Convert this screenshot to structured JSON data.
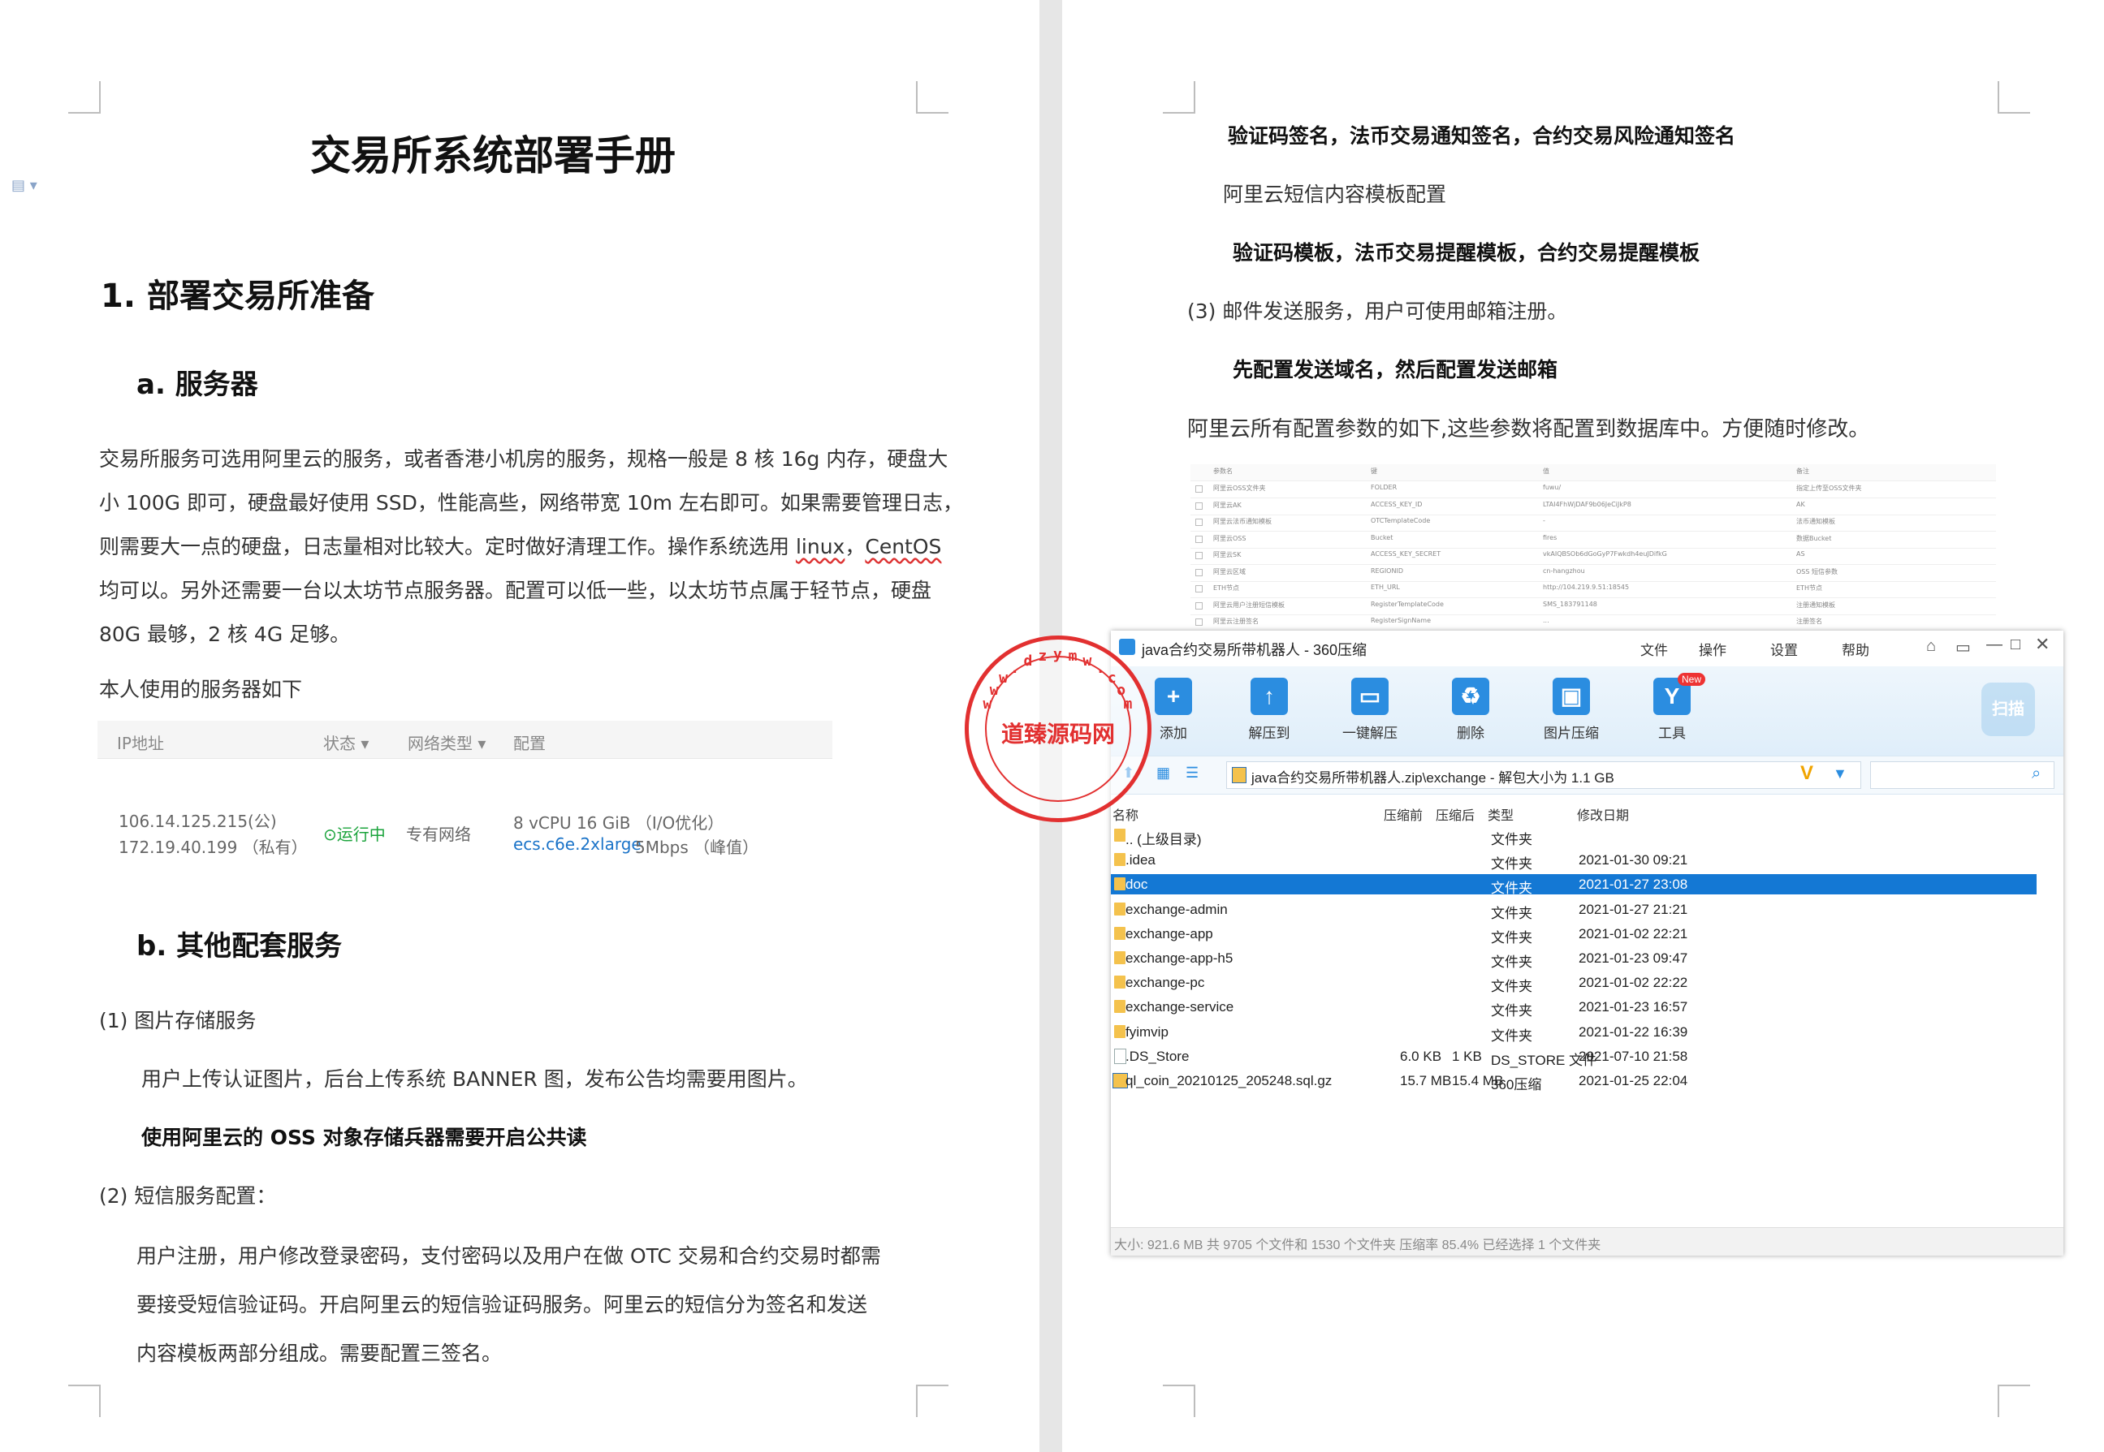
{
  "left_page": {
    "doc_title": "交易所系统部署手册",
    "section1_title": "1.  部署交易所准备",
    "sub_a_title": "a.  服务器",
    "para_lines": [
      "交易所服务可选用阿里云的服务，或者香港小机房的服务，规格一般是 8 核 16g 内存，硬盘大",
      "小 100G 即可，硬盘最好使用 SSD，性能高些，网络带宽 10m 左右即可。如果需要管理日志，",
      "则需要大一点的硬盘，日志量相对比较大。定时做好清理工作。操作系统选用 ",
      "均可以。另外还需要一台以太坊节点服务器。配置可以低一些，以太坊节点属于轻节点，硬盘",
      "80G 最够，2 核 4G 足够。"
    ],
    "os_linux": "linux",
    "os_sep": "，",
    "os_centos": "CentOS",
    "server_caption": "本人使用的服务器如下",
    "server_table": {
      "headers": [
        "IP地址",
        "状态 ▾",
        "网络类型 ▾",
        "配置"
      ],
      "ip_public": "106.14.125.215(公)",
      "ip_private": "172.19.40.199 （私有）",
      "status": "运行中",
      "network": "专有网络",
      "config_line1": "8 vCPU 16 GiB  （I/O优化）",
      "config_instance": "ecs.c6e.2xlarge",
      "config_bandwidth": "5Mbps  （峰值）"
    },
    "sub_b_title": "b.  其他配套服务",
    "item1": "(1) 图片存储服务",
    "item1_desc": "用户上传认证图片，后台上传系统 BANNER 图，发布公告均需要用图片。",
    "item1_bold": "使用阿里云的  OSS 对象存储兵器需要开启公共读",
    "item2": "(2) 短信服务配置：",
    "item2_lines": [
      "用户注册，用户修改登录密码，支付密码以及用户在做 OTC 交易和合约交易时都需",
      "要接受短信验证码。开启阿里云的短信验证码服务。阿里云的短信分为签名和发送",
      "内容模板两部分组成。需要配置三签名。"
    ]
  },
  "right_page": {
    "line_signs": "验证码签名，法币交易通知签名，合约交易风险通知签名",
    "line_template_cfg": "阿里云短信内容模板配置",
    "line_templates": "验证码模板，法币交易提醒模板，合约交易提醒模板",
    "item3": "(3) 邮件发送服务，用户可使用邮箱注册。",
    "line_mail": "先配置发送域名，然后配置发送邮箱",
    "line_params": "阿里云所有配置参数的如下,这些参数将配置到数据库中。方便随时修改。",
    "config_table": {
      "headers": [
        "参数名",
        "键",
        "值",
        "备注"
      ],
      "rows": [
        [
          "阿里云OSS文件夹",
          "FOLDER",
          "fuwu/",
          "指定上传至OSS文件夹"
        ],
        [
          "阿里云AK",
          "ACCESS_KEY_ID",
          "LTAI4FhWjDAF9b06JeCiJkP8",
          "AK"
        ],
        [
          "阿里云法币通知模板",
          "OTCTemplateCode",
          "-",
          "法币通知模板"
        ],
        [
          "阿里云OSS",
          "Bucket",
          "fires",
          "数据Bucket"
        ],
        [
          "阿里云SK",
          "ACCESS_KEY_SECRET",
          "vkAIQBSOb6dGoGyP7Fwkdh4euJDifkG",
          "AS"
        ],
        [
          "阿里云区域",
          "REGIONID",
          "cn-hangzhou",
          "OSS 短信参数"
        ],
        [
          "ETH节点",
          "ETH_URL",
          "http://104.219.9.51:18545",
          "ETH节点"
        ],
        [
          "阿里云用户注册短信模板",
          "RegisterTemplateCode",
          "SMS_183791148",
          "注册通知模板"
        ],
        [
          "阿里云注册签名",
          "RegisterSignName",
          "...",
          "注册签名"
        ]
      ]
    }
  },
  "zip_window": {
    "title": "java合约交易所带机器人 - 360压缩",
    "menu": [
      "文件",
      "操作",
      "设置",
      "帮助"
    ],
    "tools": [
      {
        "label": "添加",
        "icon": "+"
      },
      {
        "label": "解压到",
        "icon": "↑"
      },
      {
        "label": "一键解压",
        "icon": "▭"
      },
      {
        "label": "删除",
        "icon": "♻"
      },
      {
        "label": "图片压缩",
        "icon": "▣"
      },
      {
        "label": "工具",
        "icon": "Y"
      }
    ],
    "new_badge": "New",
    "scan_label": "扫描",
    "path": "java合约交易所带机器人.zip\\exchange - 解包大小为 1.1 GB",
    "columns": [
      "名称",
      "压缩前",
      "压缩后",
      "类型",
      "修改日期"
    ],
    "files": [
      {
        "name": ".. (上级目录)",
        "before": "",
        "after": "",
        "type": "文件夹",
        "date": "",
        "kind": "folder"
      },
      {
        "name": ".idea",
        "before": "",
        "after": "",
        "type": "文件夹",
        "date": "2021-01-30 09:21",
        "kind": "folder"
      },
      {
        "name": "doc",
        "before": "",
        "after": "",
        "type": "文件夹",
        "date": "2021-01-27 23:08",
        "kind": "folder"
      },
      {
        "name": "exchange-admin",
        "before": "",
        "after": "",
        "type": "文件夹",
        "date": "2021-01-27 21:21",
        "kind": "folder"
      },
      {
        "name": "exchange-app",
        "before": "",
        "after": "",
        "type": "文件夹",
        "date": "2021-01-02 22:21",
        "kind": "folder"
      },
      {
        "name": "exchange-app-h5",
        "before": "",
        "after": "",
        "type": "文件夹",
        "date": "2021-01-23 09:47",
        "kind": "folder"
      },
      {
        "name": "exchange-pc",
        "before": "",
        "after": "",
        "type": "文件夹",
        "date": "2021-01-02 22:22",
        "kind": "folder"
      },
      {
        "name": "exchange-service",
        "before": "",
        "after": "",
        "type": "文件夹",
        "date": "2021-01-23 16:57",
        "kind": "folder"
      },
      {
        "name": "fyimvip",
        "before": "",
        "after": "",
        "type": "文件夹",
        "date": "2021-01-22 16:39",
        "kind": "folder"
      },
      {
        "name": ".DS_Store",
        "before": "6.0 KB",
        "after": "1 KB",
        "type": "DS_STORE 文件",
        "date": "2021-07-10 21:58",
        "kind": "file"
      },
      {
        "name": "ql_coin_20210125_205248.sql.gz",
        "before": "15.7 MB",
        "after": "15.4 MB",
        "type": "360压缩",
        "date": "2021-01-25 22:04",
        "kind": "zip"
      }
    ],
    "selected_index": 2,
    "status": "大小: 921.6 MB 共 9705 个文件和 1530 个文件夹 压缩率 85.4% 已经选择 1 个文件夹"
  },
  "stamp": {
    "center_text": "道臻源码网",
    "ring_text": "www.dzymw.com"
  },
  "colors": {
    "selection": "#1478d4",
    "accent_blue": "#2b8de0",
    "stamp_red": "#e23030",
    "status_green": "#1aa33b"
  }
}
